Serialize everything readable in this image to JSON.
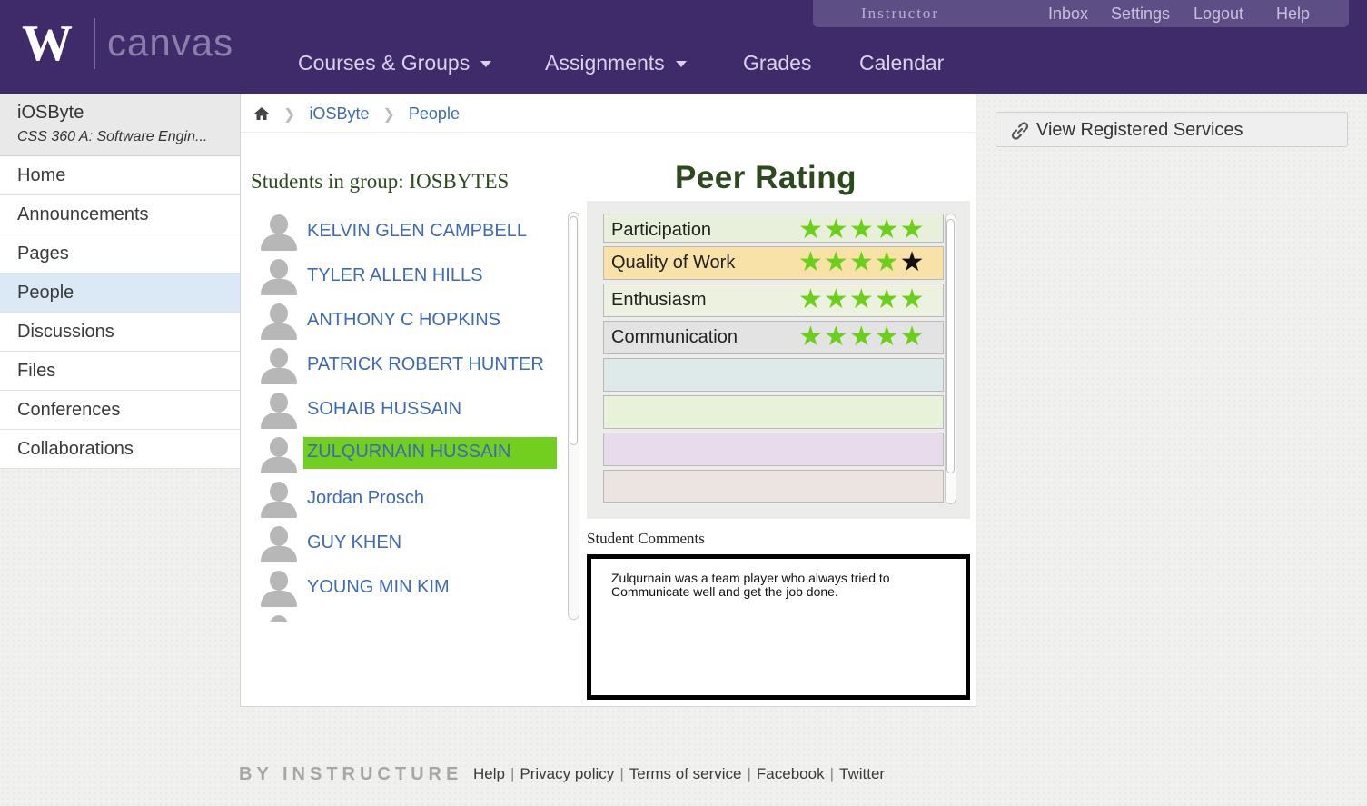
{
  "header": {
    "logo_letter": "W",
    "logo_text": "canvas",
    "role": "Instructor",
    "top_links": [
      "Inbox",
      "Settings",
      "Logout",
      "Help"
    ],
    "main_nav": [
      {
        "label": "Courses & Groups",
        "has_dropdown": true
      },
      {
        "label": "Assignments",
        "has_dropdown": true
      },
      {
        "label": "Grades",
        "has_dropdown": false
      },
      {
        "label": "Calendar",
        "has_dropdown": false
      }
    ]
  },
  "course": {
    "name": "iOSByte",
    "subtitle": "CSS 360 A: Software Engin..."
  },
  "sidebar": {
    "items": [
      {
        "label": "Home",
        "active": false
      },
      {
        "label": "Announcements",
        "active": false
      },
      {
        "label": "Pages",
        "active": false
      },
      {
        "label": "People",
        "active": true
      },
      {
        "label": "Discussions",
        "active": false
      },
      {
        "label": "Files",
        "active": false
      },
      {
        "label": "Conferences",
        "active": false
      },
      {
        "label": "Collaborations",
        "active": false
      }
    ]
  },
  "breadcrumb": {
    "home_icon": "home-icon",
    "items": [
      "iOSByte",
      "People"
    ]
  },
  "group": {
    "title": "Students in group: IOSBYTES",
    "students": [
      {
        "name": "KELVIN GLEN CAMPBELL",
        "selected": false
      },
      {
        "name": "TYLER ALLEN HILLS",
        "selected": false
      },
      {
        "name": "ANTHONY C HOPKINS",
        "selected": false
      },
      {
        "name": "PATRICK ROBERT HUNTER",
        "selected": false
      },
      {
        "name": "SOHAIB HUSSAIN",
        "selected": false
      },
      {
        "name": "ZULQURNAIN HUSSAIN",
        "selected": true
      },
      {
        "name": "Jordan Prosch",
        "selected": false
      },
      {
        "name": "GUY KHEN",
        "selected": false
      },
      {
        "name": "YOUNG MIN KIM",
        "selected": false
      }
    ]
  },
  "peer_rating": {
    "title": "Peer Rating",
    "criteria": [
      {
        "label": "Participation",
        "stars": 5,
        "max": 5,
        "bg": "#e8f0dc"
      },
      {
        "label": "Quality of Work",
        "stars": 4,
        "max": 5,
        "bg": "#f8e2a8"
      },
      {
        "label": "Enthusiasm",
        "stars": 5,
        "max": 5,
        "bg": "#edf2e0"
      },
      {
        "label": "Communication",
        "stars": 5,
        "max": 5,
        "bg": "#e3e3e3"
      }
    ],
    "empty_row_colors": [
      "#deeaea",
      "#e8f2d8",
      "#e8dcec",
      "#ece4e0"
    ]
  },
  "comments": {
    "label": "Student Comments",
    "text": "Zulqurnain was a team player who always tried to Communicate well and get the job done."
  },
  "services": {
    "label": "View Registered Services",
    "icon": "link-icon"
  },
  "footer": {
    "brand": "BY INSTRUCTURE",
    "links": [
      "Help",
      "Privacy policy",
      "Terms of service",
      "Facebook",
      "Twitter"
    ]
  },
  "colors": {
    "header_bg": "#3f2a6a",
    "link": "#3d6ab3",
    "selected_student": "#72cf1f",
    "star": "#6ccf19",
    "active_nav": "#dbe9f6"
  }
}
